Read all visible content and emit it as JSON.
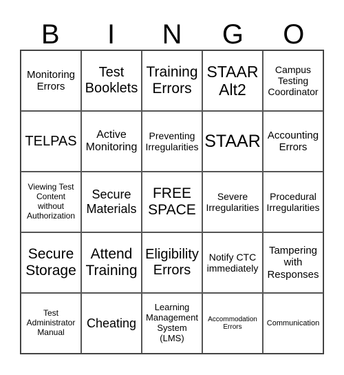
{
  "header": [
    "B",
    "I",
    "N",
    "G",
    "O"
  ],
  "cells": [
    "Monitoring Errors",
    "Test Booklets",
    "Training Errors",
    "STAAR Alt2",
    "Campus Testing Coordinator",
    "TELPAS",
    "Active Monitoring",
    "Preventing Irregularities",
    "STAAR",
    "Accounting Errors",
    "Viewing Test Content without Authorization",
    "Secure Materials",
    "FREE SPACE",
    "Severe Irregularities",
    "Procedural Irregularities",
    "Secure Storage",
    "Attend Training",
    "Eligibility Errors",
    "Notify CTC immediately",
    "Tampering with Responses",
    "Test Administrator Manual",
    "Cheating",
    "Learning Management System (LMS)",
    "Accommodation Errors",
    "Communication"
  ]
}
